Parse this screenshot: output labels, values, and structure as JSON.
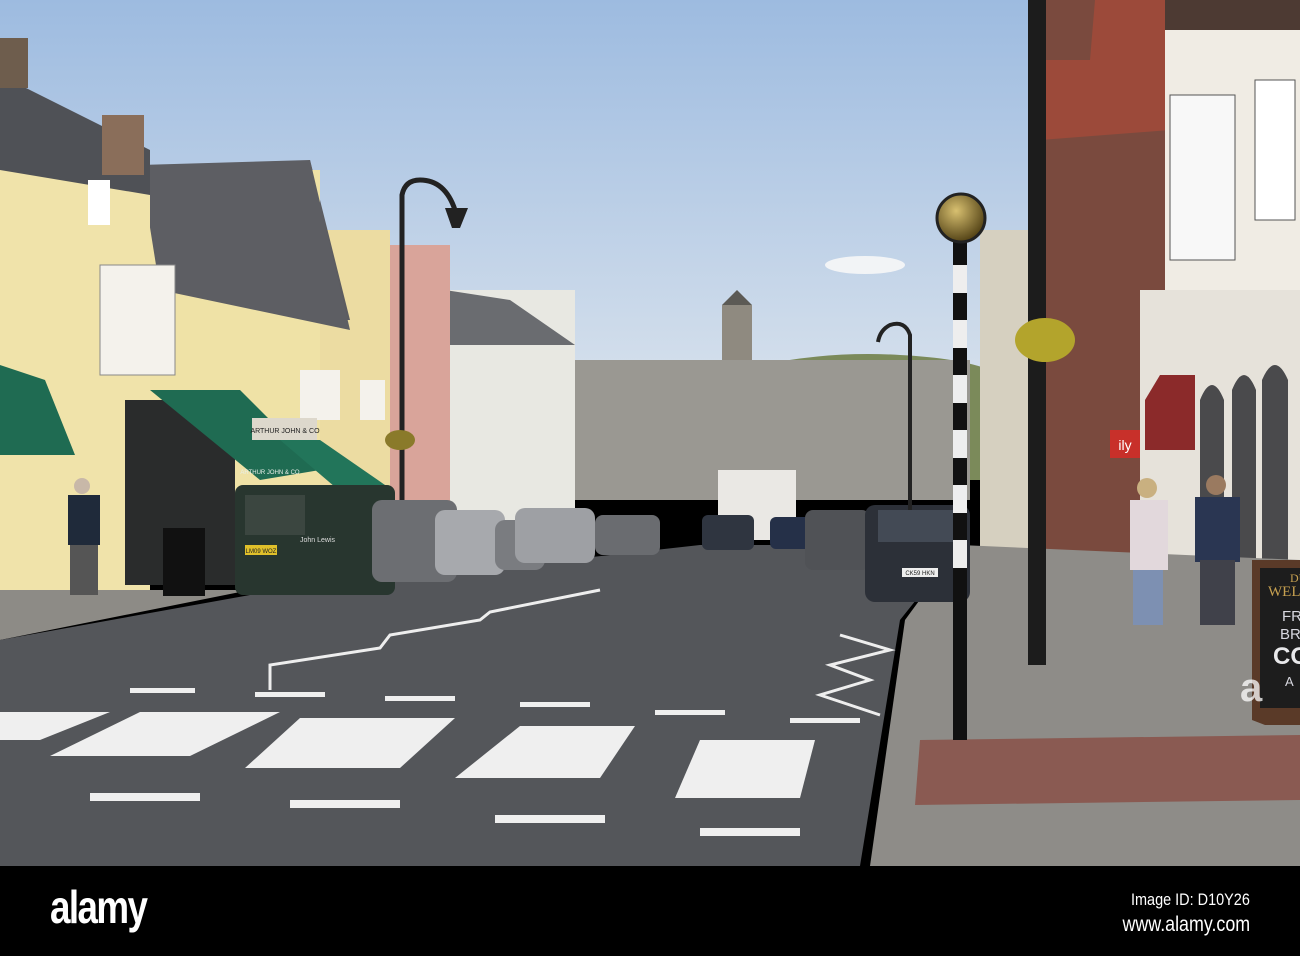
{
  "photo": {
    "signs": {
      "shop_fascia": "ARTHUR JOHN & CO",
      "awning_text": "ARTHUR JOHN & CO",
      "van_livery": "John Lewis",
      "van_plate": "LM09 WOZ",
      "car_plate": "CK59 HKN",
      "red_sign": "ily",
      "aboard_title_1": "DU",
      "aboard_title_2": "WELL",
      "aboard_line_1": "FR",
      "aboard_line_2": "BR",
      "aboard_line_3": "CO",
      "aboard_line_4": "A"
    },
    "colors": {
      "sky_top": "#9dbbe0",
      "sky_bottom": "#e3e9ef",
      "road": "#54565a",
      "awning": "#1f6b52",
      "facade_yellow": "#efe2a6"
    }
  },
  "watermark": {
    "logo": "alamy",
    "mark_letter": "a",
    "image_id": "Image ID: D10Y26",
    "url": "www.alamy.com"
  }
}
